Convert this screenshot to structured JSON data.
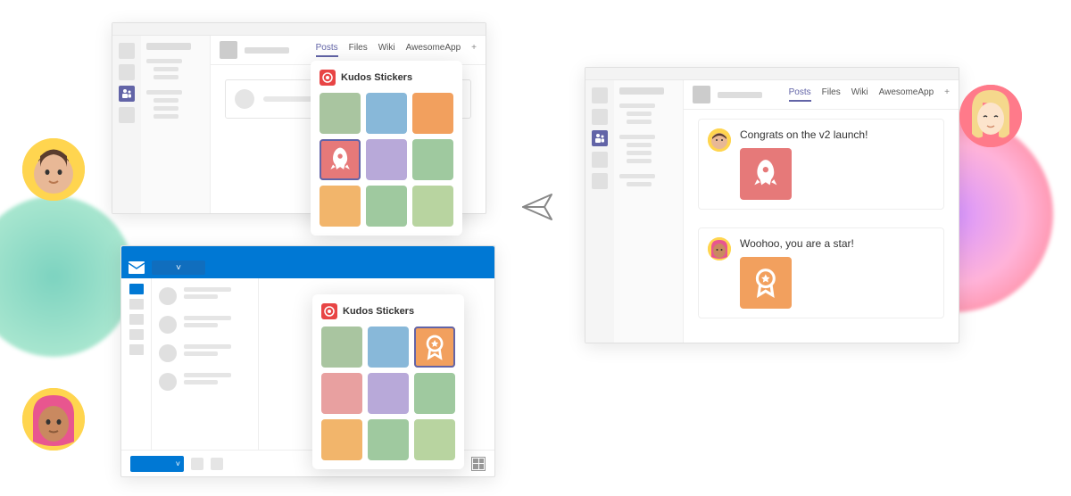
{
  "tabs": {
    "posts": "Posts",
    "files": "Files",
    "wiki": "Wiki",
    "awesomeapp": "AwesomeApp",
    "plus": "+"
  },
  "stickers": {
    "title": "Kudos Stickers",
    "colors": [
      "#a9c5a0",
      "#88b8d9",
      "#f2a05e",
      "#e67979",
      "#b8a9d9",
      "#9fc99f",
      "#f2b56b",
      "#9fc99f",
      "#b8d4a0"
    ]
  },
  "outlook": {
    "send_chev": "˅"
  },
  "messages": [
    {
      "author": "user1",
      "text": "Congrats on the v2 launch!",
      "sticker": "rocket",
      "bg": "#e67979"
    },
    {
      "author": "user2",
      "text": "Woohoo, you are a star!",
      "sticker": "ribbon",
      "bg": "#f2a05e"
    }
  ],
  "avatar_colors": {
    "a1_hair": "#6b4a3a",
    "a2_scarf": "#e8568f",
    "a3_hair": "#f5d88c"
  }
}
